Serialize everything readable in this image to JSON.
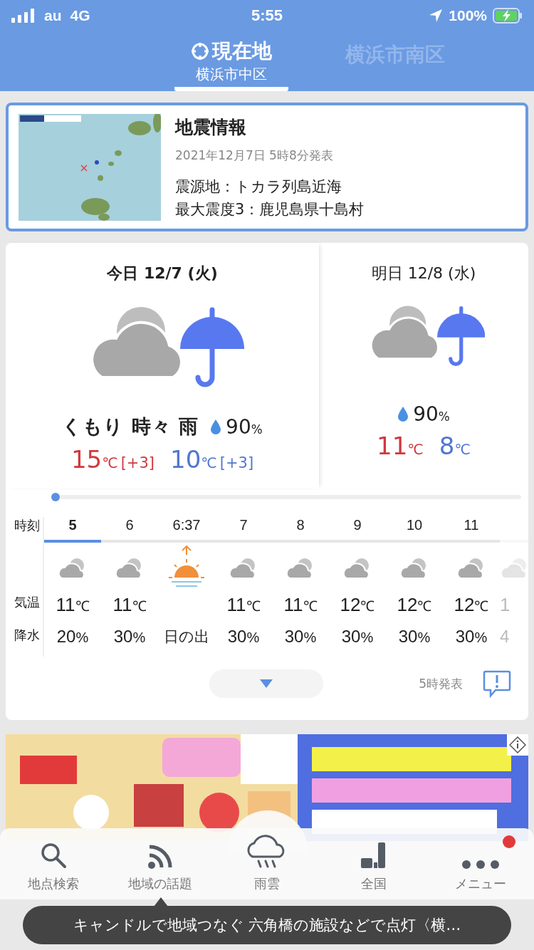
{
  "status_bar": {
    "carrier": "au",
    "network": "4G",
    "time": "5:55",
    "battery": "100%"
  },
  "tabs": [
    {
      "title": "現在地",
      "subtitle": "横浜市中区",
      "selected": true
    },
    {
      "title": "横浜市南区",
      "selected": false
    }
  ],
  "quake": {
    "image": {
      "kind": "picture"
    },
    "title": "地震情報",
    "date": "2021年12月7日 5時8分発表",
    "lines": [
      "震源地：トカラ列島近海",
      "最大震度3：鹿児島県十島村"
    ]
  },
  "days": [
    {
      "label": "今日 12/7 (火)",
      "condition": "くもり 時々 雨",
      "rain": "90",
      "rain_unit": "%",
      "high": "15",
      "high_unit": "℃",
      "high_diff": "[+3]",
      "low": "10",
      "low_unit": "℃",
      "low_diff": "[+3]"
    },
    {
      "label": "明日 12/8 (水)",
      "rain": "90",
      "rain_unit": "%",
      "high": "11",
      "high_unit": "℃",
      "low": "8",
      "low_unit": "℃"
    }
  ],
  "hourly": {
    "labels": [
      "時刻",
      "気温",
      "降水"
    ],
    "columns": [
      {
        "hour": "5",
        "kind": "cloudy",
        "temp": "11",
        "unit": "℃",
        "precip": "20",
        "precip_unit": "%",
        "selected": true
      },
      {
        "hour": "6",
        "kind": "cloudy",
        "temp": "11",
        "unit": "℃",
        "precip": "30",
        "precip_unit": "%",
        "selected": false
      },
      {
        "hour": "6:37",
        "kind": "sunrise",
        "precip": "日の出",
        "selected": false
      },
      {
        "hour": "7",
        "kind": "cloudy",
        "temp": "11",
        "unit": "℃",
        "precip": "30",
        "precip_unit": "%",
        "selected": false
      },
      {
        "hour": "8",
        "kind": "cloudy",
        "temp": "11",
        "unit": "℃",
        "precip": "30",
        "precip_unit": "%",
        "selected": false
      },
      {
        "hour": "9",
        "kind": "cloudy",
        "temp": "12",
        "unit": "℃",
        "precip": "30",
        "precip_unit": "%",
        "selected": false
      },
      {
        "hour": "10",
        "kind": "cloudy",
        "temp": "12",
        "unit": "℃",
        "precip": "30",
        "precip_unit": "%",
        "selected": false
      },
      {
        "hour": "11",
        "kind": "cloudy",
        "temp": "12",
        "unit": "℃",
        "precip": "30",
        "precip_unit": "%",
        "selected": false
      },
      {
        "kind": "cloudy",
        "temp": "1",
        "precip": "4"
      }
    ],
    "issued": "5時発表"
  },
  "ad": {
    "kind": "picture"
  },
  "nav": [
    {
      "label": "地点検索",
      "kind": "search",
      "badge": false
    },
    {
      "label": "地域の話題",
      "kind": "feed",
      "badge": false
    },
    {
      "label": "雨雲",
      "kind": "rain",
      "badge": false
    },
    {
      "label": "全国",
      "kind": "bars",
      "badge": false
    },
    {
      "label": "メニュー",
      "kind": "dots",
      "badge": true
    }
  ],
  "toast": "キャンドルで地域つなぐ 六角橋の施設などで点灯〈横…"
}
